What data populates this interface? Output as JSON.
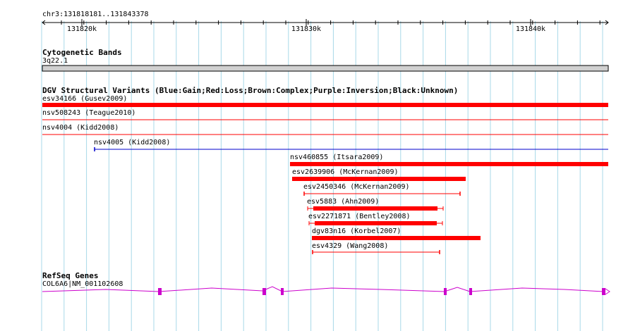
{
  "ruler": {
    "location": "chr3:131818181..131843378",
    "ticks": [
      {
        "label": "131820k",
        "bp": 131820000
      },
      {
        "label": "131830k",
        "bp": 131830000
      },
      {
        "label": "131840k",
        "bp": 131840000
      }
    ]
  },
  "cytobands": {
    "title": "Cytogenetic Bands",
    "band": "3q22.1"
  },
  "dgv": {
    "title": "DGV Structural Variants (Blue:Gain;Red:Loss;Brown:Complex;Purple:Inversion;Black:Unknown)",
    "colors": {
      "gain": "#0000cc",
      "loss": "#ff0000"
    },
    "variants": [
      {
        "label": "esv34166 (Gusev2009)",
        "type": "loss",
        "style": "thick"
      },
      {
        "label": "nsv508243 (Teague2010)",
        "type": "loss",
        "style": "line"
      },
      {
        "label": "nsv4004 (Kidd2008)",
        "type": "loss",
        "style": "line"
      },
      {
        "label": "nsv4005 (Kidd2008)",
        "type": "gain",
        "style": "line"
      },
      {
        "label": "nsv460855 (Itsara2009)",
        "type": "loss",
        "style": "thick"
      },
      {
        "label": "esv2639906 (McKernan2009)",
        "type": "loss",
        "style": "thick"
      },
      {
        "label": "esv2450346 (McKernan2009)",
        "type": "loss",
        "style": "line"
      },
      {
        "label": "esv5883 (Ahn2009)",
        "type": "loss",
        "style": "thick"
      },
      {
        "label": "esv2271871 (Bentley2008)",
        "type": "loss",
        "style": "thick"
      },
      {
        "label": "dgv83n16 (Korbel2007)",
        "type": "loss",
        "style": "thick"
      },
      {
        "label": "esv4329 (Wang2008)",
        "type": "loss",
        "style": "line"
      }
    ]
  },
  "refseq": {
    "title": "RefSeq Genes",
    "gene": "COL6A6|NM_001102608",
    "color": "#cc00cc"
  }
}
